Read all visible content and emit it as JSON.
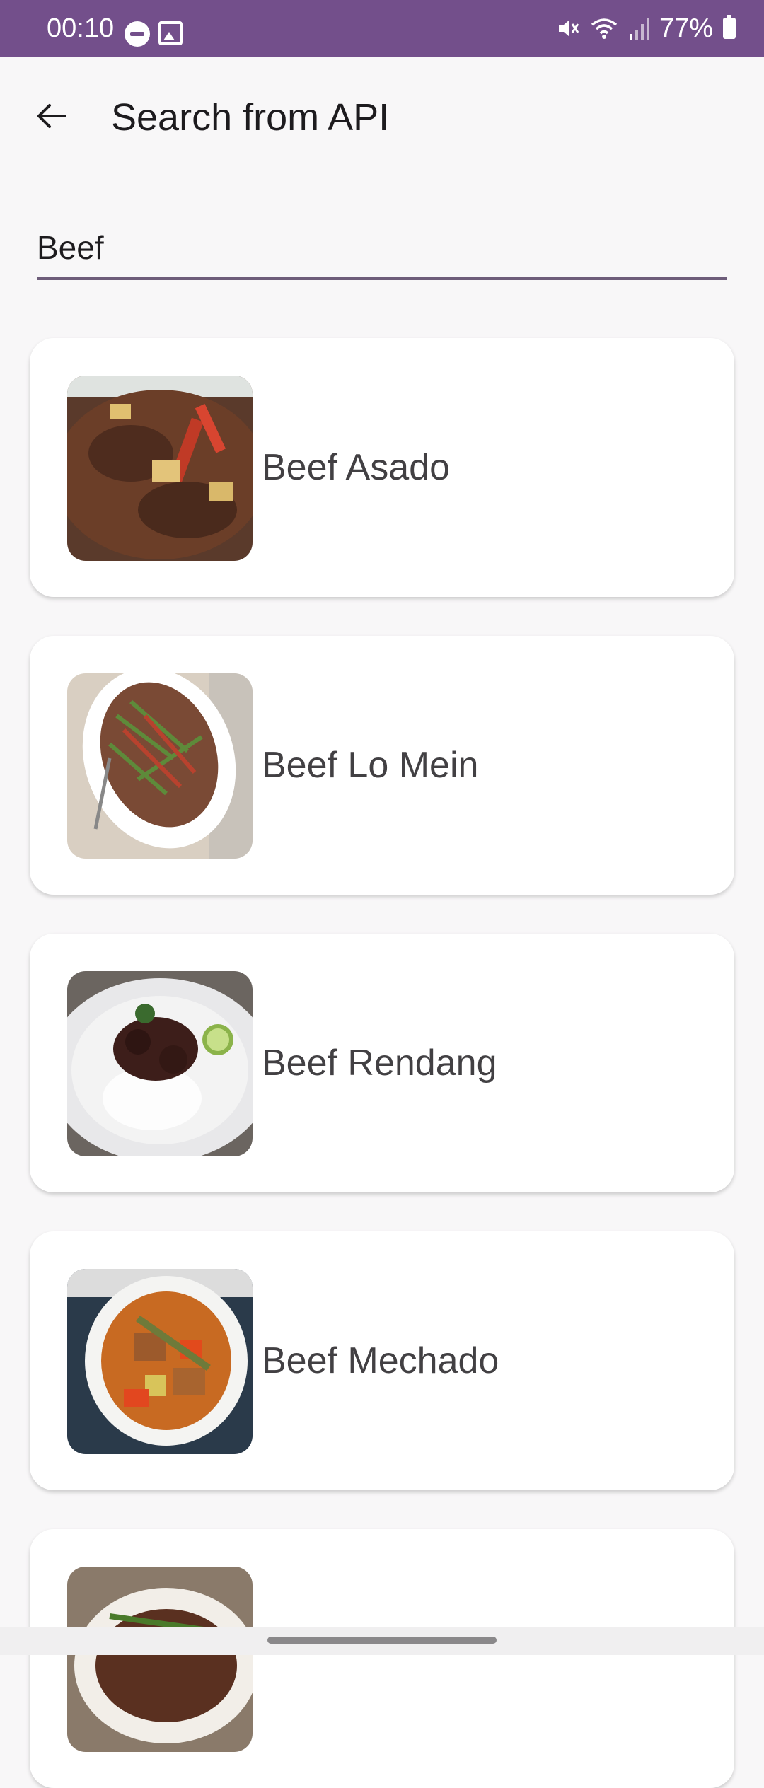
{
  "status_bar": {
    "time": "00:10",
    "battery": "77%"
  },
  "app_bar": {
    "title": "Search from API"
  },
  "search": {
    "value": "Beef"
  },
  "results": [
    {
      "title": "Beef Asado"
    },
    {
      "title": "Beef Lo Mein"
    },
    {
      "title": "Beef Rendang"
    },
    {
      "title": "Beef Mechado"
    },
    {
      "title": ""
    }
  ],
  "colors": {
    "status_bar": "#734f8b",
    "underline": "#6e5d7a",
    "background": "#f8f7f8"
  }
}
